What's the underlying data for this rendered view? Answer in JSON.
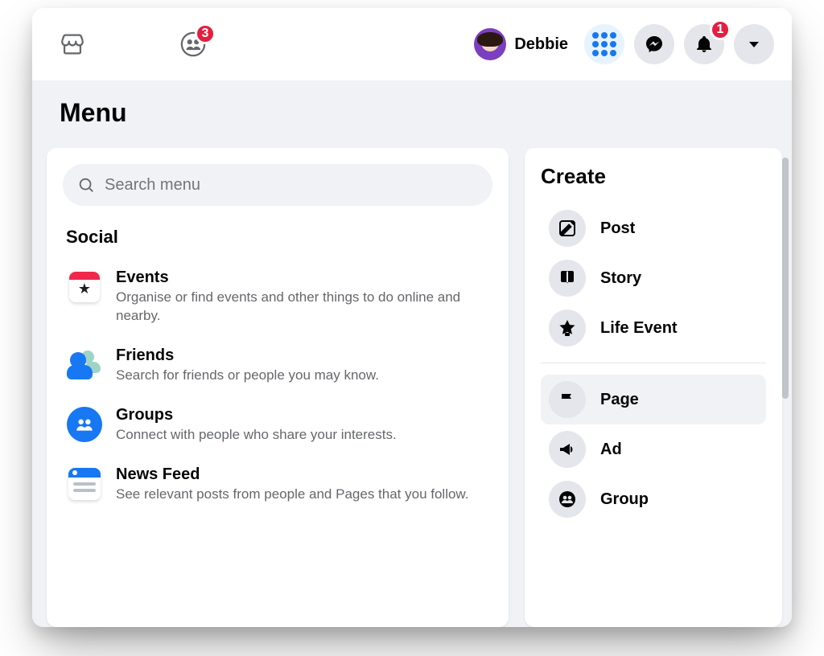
{
  "header": {
    "groups_badge": "3",
    "bell_badge": "1",
    "profile_name": "Debbie"
  },
  "page": {
    "title": "Menu",
    "search_placeholder": "Search menu"
  },
  "social": {
    "heading": "Social",
    "items": [
      {
        "id": "events",
        "title": "Events",
        "desc": "Organise or find events and other things to do online and nearby."
      },
      {
        "id": "friends",
        "title": "Friends",
        "desc": "Search for friends or people you may know."
      },
      {
        "id": "groups",
        "title": "Groups",
        "desc": "Connect with people who share your interests."
      },
      {
        "id": "feed",
        "title": "News Feed",
        "desc": "See relevant posts from people and Pages that you follow."
      }
    ]
  },
  "create": {
    "heading": "Create",
    "top": [
      {
        "id": "post",
        "label": "Post"
      },
      {
        "id": "story",
        "label": "Story"
      },
      {
        "id": "life",
        "label": "Life Event"
      }
    ],
    "bottom": [
      {
        "id": "page",
        "label": "Page",
        "selected": true
      },
      {
        "id": "ad",
        "label": "Ad"
      },
      {
        "id": "group",
        "label": "Group"
      }
    ]
  }
}
